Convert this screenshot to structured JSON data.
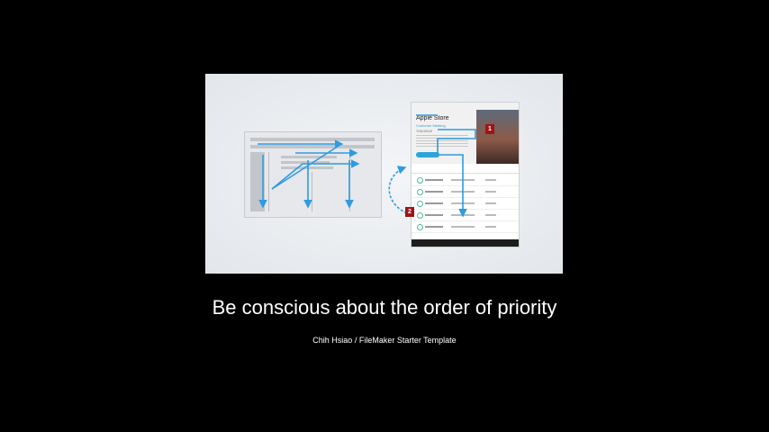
{
  "slide": {
    "caption": "Be conscious about the order of priority",
    "credit": "Chih Hsiao / FileMaker Starter Template"
  },
  "illustration": {
    "device_title": "Apple Store",
    "device_subtitle": "Customer Meeting",
    "device_date": "7/31/2015",
    "badges": [
      "1",
      "2"
    ],
    "colors": {
      "arrow": "#2f9be0",
      "badge": "#a01414",
      "background": "#000000"
    }
  }
}
